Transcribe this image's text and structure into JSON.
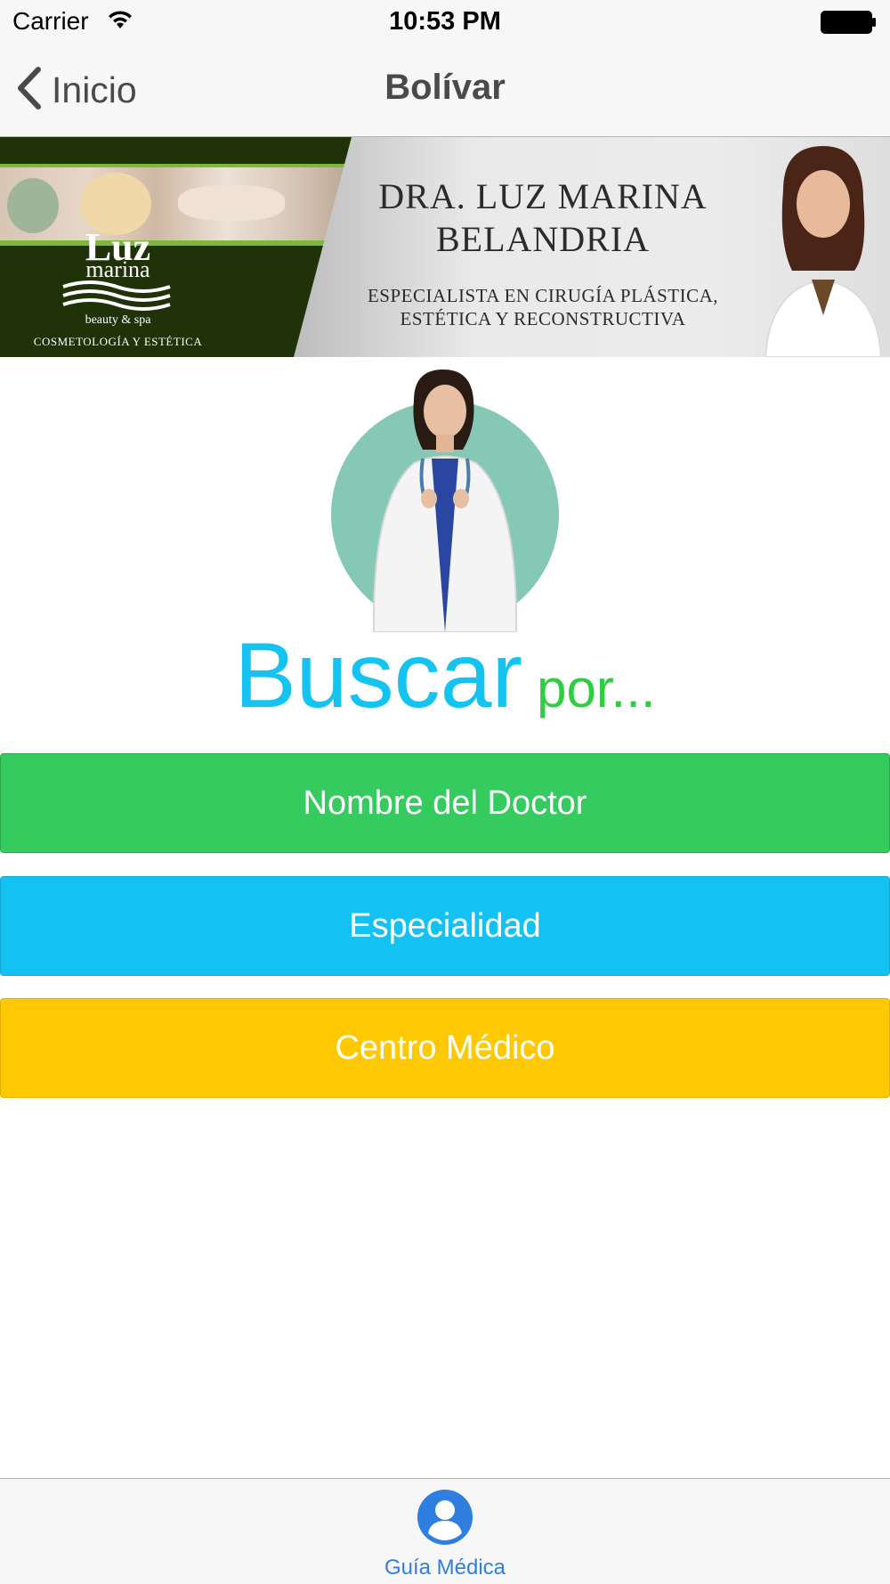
{
  "status_bar": {
    "carrier": "Carrier",
    "time": "10:53 PM",
    "wifi_icon": "wifi-icon",
    "battery_icon": "battery-icon"
  },
  "nav": {
    "back_label": "Inicio",
    "back_icon": "chevron-left-icon",
    "title": "Bolívar"
  },
  "banner": {
    "logo_main": "Luz",
    "logo_second": "marina",
    "logo_sub": "beauty & spa",
    "logo_tagline": "COSMETOLOGÍA Y ESTÉTICA",
    "doctor_line1": "DRA. LUZ MARINA",
    "doctor_line2": "BELANDRIA",
    "specialty_line1": "ESPECIALISTA EN CIRUGÍA PLÁSTICA,",
    "specialty_line2": "ESTÉTICA Y RECONSTRUCTIVA"
  },
  "heading": {
    "big": "Buscar",
    "small": "por..."
  },
  "buttons": {
    "doctor_name": "Nombre del Doctor",
    "specialty": "Especialidad",
    "medical_center": "Centro Médico"
  },
  "tab_bar": {
    "items": [
      {
        "label": "Guía Médica",
        "icon": "user-icon",
        "selected": true
      }
    ]
  },
  "colors": {
    "accent_blue": "#14c3f0",
    "accent_green": "#2fcd41",
    "button_green": "#35cb5e",
    "button_blue": "#13c2f2",
    "button_yellow": "#fec902",
    "tab_active": "#2f7fe0"
  }
}
